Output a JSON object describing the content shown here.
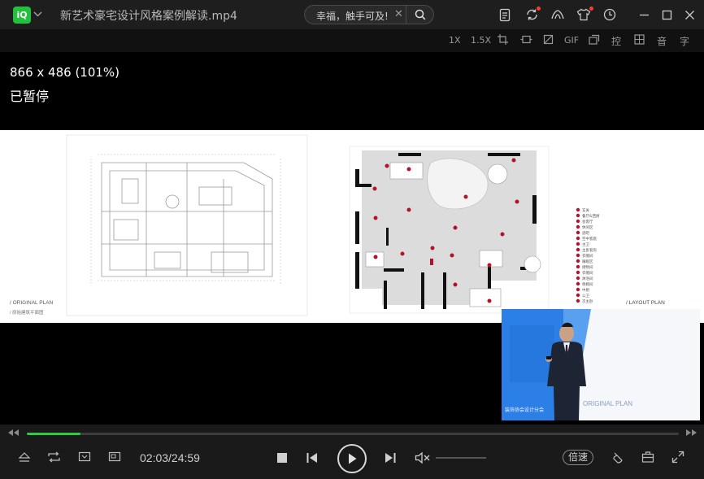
{
  "app": {
    "logo_text": "iQ",
    "file_title": "新艺术豪宅设计风格案例解读.mp4"
  },
  "search": {
    "query": "幸福，触手可及!"
  },
  "title_icons": [
    "document-icon",
    "sync-icon",
    "skin-icon",
    "shirt-icon",
    "history-icon",
    "minimize-icon",
    "maximize-icon",
    "close-icon"
  ],
  "toolbar": {
    "items": [
      "1X",
      "1.5X",
      "crop",
      "frame",
      "rotate",
      "GIF",
      "cast",
      "控",
      "▦",
      "音",
      "字"
    ],
    "speed_1x": "1X",
    "speed_15x": "1.5X",
    "gif": "GIF",
    "control": "控",
    "audio": "音",
    "subtitle": "字"
  },
  "osd": {
    "size": "866 x 486 (101%)",
    "state": "已暂停"
  },
  "slide": {
    "left_caption_en": "/ ORIGINAL PLAN",
    "left_caption_cn": "/ 原始建筑平面图",
    "right_caption_en": "/ LAYOUT PLAN",
    "legend": [
      "玄关",
      "餐厅&西厨",
      "会客厅",
      "休闲区",
      "酒吧",
      "空中客庭",
      "主卫",
      "主卧套房",
      "衣帽间",
      "睡眠区",
      "储物间",
      "衣帽间",
      "淋浴间",
      "保姆间",
      "中厨",
      "公卫",
      "次主卧"
    ]
  },
  "pip": {
    "caption_en": "ORIGINAL PLAN",
    "caption_cn": "装饰协会设计分会"
  },
  "playback": {
    "current": "02:03",
    "duration": "24:59",
    "time_display": "02:03/24:59",
    "progress": 0.082,
    "volume": 0,
    "speed_label": "倍速"
  },
  "colors": {
    "accent": "#2ecc40",
    "logo": "#22c03c",
    "notify": "#ff3b30",
    "plan_red": "#b3122a"
  }
}
